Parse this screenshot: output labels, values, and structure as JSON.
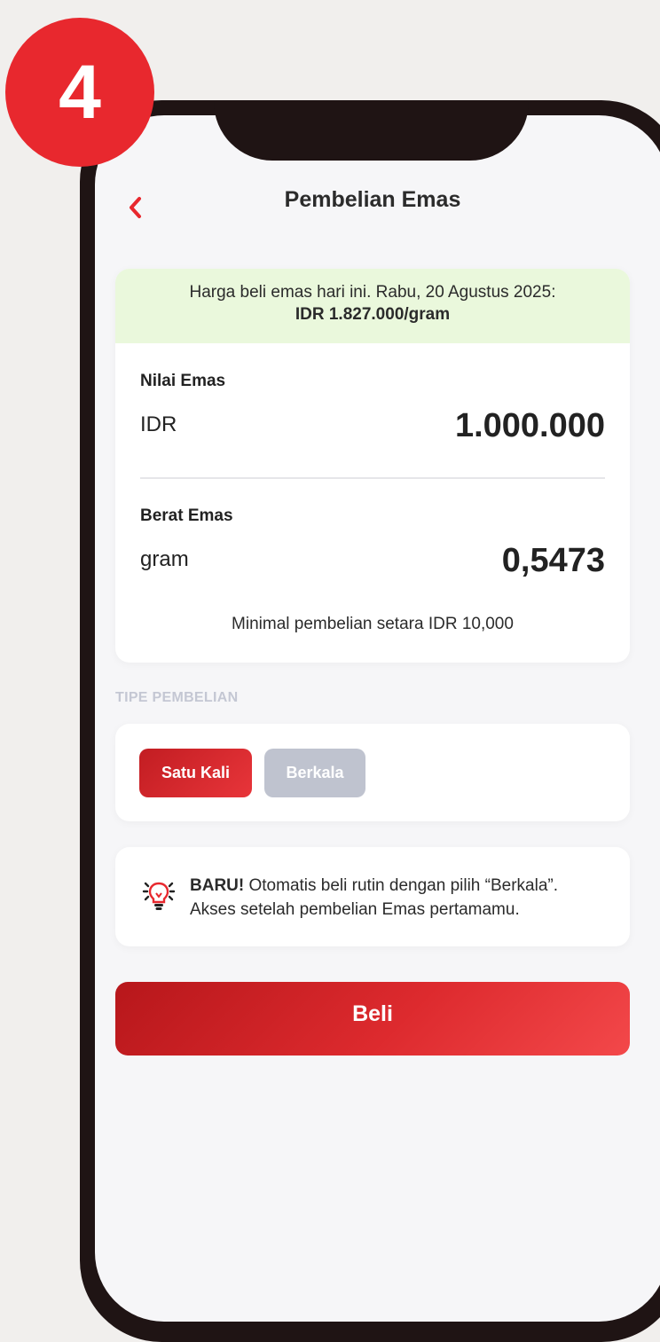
{
  "step": {
    "number": "4"
  },
  "header": {
    "title": "Pembelian Emas"
  },
  "price_banner": {
    "line1": "Harga beli emas hari ini. Rabu, 20 Agustus 2025:",
    "price": "IDR 1.827.000/gram"
  },
  "gold_value": {
    "label": "Nilai Emas",
    "unit": "IDR",
    "value": "1.000.000"
  },
  "gold_weight": {
    "label": "Berat Emas",
    "unit": "gram",
    "value": "0,5473"
  },
  "min_note": "Minimal pembelian setara IDR 10,000",
  "purchase_type": {
    "label": "TIPE PEMBELIAN",
    "options": [
      {
        "label": "Satu Kali",
        "selected": true
      },
      {
        "label": "Berkala",
        "selected": false
      }
    ]
  },
  "info": {
    "icon": "lightbulb-icon",
    "bold": "BARU!",
    "text_line1": " Otomatis beli rutin dengan pilih “Berkala”.",
    "text_line2": "Akses setelah pembelian Emas pertamamu."
  },
  "buy_button": {
    "label": "Beli"
  },
  "colors": {
    "accent": "#e8282e",
    "banner_bg": "#eaf8dc",
    "inactive": "#bfc3cf",
    "phone_frame": "#1f1414"
  }
}
